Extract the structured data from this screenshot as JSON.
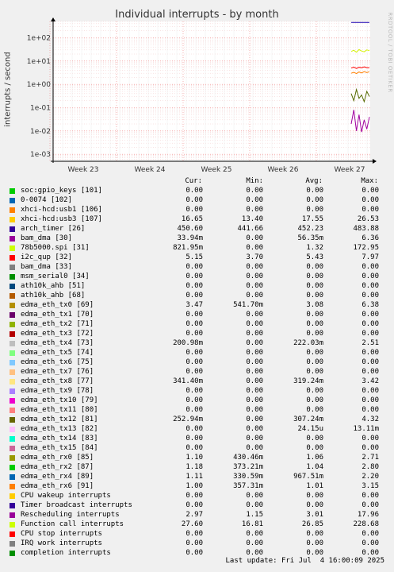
{
  "chart_data": {
    "type": "line",
    "title": "Individual interrupts - by month",
    "ylabel": "interrupts / second",
    "watermark": "RRDTOOL / TOBI OETIKER",
    "yscale": "log",
    "ylim": [
      0.0005,
      500
    ],
    "y_ticks": [
      {
        "value": 100,
        "label": "1e+02"
      },
      {
        "value": 10,
        "label": "1e+01"
      },
      {
        "value": 1,
        "label": "1e+00"
      },
      {
        "value": 0.1,
        "label": "1e-01"
      },
      {
        "value": 0.01,
        "label": "1e-02"
      },
      {
        "value": 0.001,
        "label": "1e-03"
      }
    ],
    "x_ticks": [
      "Week 23",
      "Week 24",
      "Week 25",
      "Week 26",
      "Week 27"
    ],
    "grid": true,
    "series": [
      {
        "name": "arch_timer [26]",
        "color": "#1a00b0",
        "values": [
          450,
          450,
          452,
          451,
          450,
          452,
          450,
          451
        ]
      },
      {
        "name": "Function call interrupts",
        "color": "#d4f000",
        "values": [
          26,
          29,
          24,
          31,
          27,
          25,
          30,
          28
        ]
      },
      {
        "name": "edma_eth_tx12 [81]",
        "color": "#556b00",
        "values": [
          0.4,
          0.2,
          0.6,
          0.25,
          0.35,
          0.18,
          0.5,
          0.3
        ]
      },
      {
        "name": "Rescheduling interrupts",
        "color": "#a000a0",
        "values": [
          0.02,
          0.08,
          0.01,
          0.05,
          0.009,
          0.03,
          0.012,
          0.04
        ]
      },
      {
        "name": "edma_eth_tx0 [69]",
        "color": "#ff7f00",
        "values": [
          3.0,
          3.3,
          2.9,
          3.4,
          3.1,
          3.5,
          3.2,
          3.47
        ]
      },
      {
        "name": "i2c_qup [32]",
        "color": "#ff0000",
        "values": [
          5.0,
          5.5,
          4.8,
          5.4,
          5.1,
          5.6,
          5.2,
          5.15
        ]
      }
    ]
  },
  "legend": {
    "headers": {
      "cur": "Cur:",
      "min": "Min:",
      "avg": "Avg:",
      "max": "Max:"
    },
    "rows": [
      {
        "name": "soc:gpio_keys [101]",
        "color": "#00cc00",
        "cur": "0.00",
        "min": "0.00",
        "avg": "0.00",
        "max": "0.00"
      },
      {
        "name": "0-0074 [102]",
        "color": "#0066b3",
        "cur": "0.00",
        "min": "0.00",
        "avg": "0.00",
        "max": "0.00"
      },
      {
        "name": "xhci-hcd:usb1 [106]",
        "color": "#ff8000",
        "cur": "0.00",
        "min": "0.00",
        "avg": "0.00",
        "max": "0.00"
      },
      {
        "name": "xhci-hcd:usb3 [107]",
        "color": "#ffcc00",
        "cur": "16.65",
        "min": "13.40",
        "avg": "17.55",
        "max": "26.53"
      },
      {
        "name": "arch_timer [26]",
        "color": "#330099",
        "cur": "450.60",
        "min": "441.66",
        "avg": "452.23",
        "max": "483.88"
      },
      {
        "name": "bam_dma [30]",
        "color": "#990099",
        "cur": "33.94m",
        "min": "0.00",
        "avg": "56.35m",
        "max": "6.36"
      },
      {
        "name": "78b5000.spi [31]",
        "color": "#ccff00",
        "cur": "821.95m",
        "min": "0.00",
        "avg": "1.32",
        "max": "172.95"
      },
      {
        "name": "i2c_qup [32]",
        "color": "#ff0000",
        "cur": "5.15",
        "min": "3.70",
        "avg": "5.43",
        "max": "7.97"
      },
      {
        "name": "bam_dma [33]",
        "color": "#808080",
        "cur": "0.00",
        "min": "0.00",
        "avg": "0.00",
        "max": "0.00"
      },
      {
        "name": "msm_serial0 [34]",
        "color": "#008f00",
        "cur": "0.00",
        "min": "0.00",
        "avg": "0.00",
        "max": "0.00"
      },
      {
        "name": "ath10k_ahb [51]",
        "color": "#00487d",
        "cur": "0.00",
        "min": "0.00",
        "avg": "0.00",
        "max": "0.00"
      },
      {
        "name": "ath10k_ahb [68]",
        "color": "#b35a00",
        "cur": "0.00",
        "min": "0.00",
        "avg": "0.00",
        "max": "0.00"
      },
      {
        "name": "edma_eth_tx0 [69]",
        "color": "#b38f00",
        "cur": "3.47",
        "min": "541.70m",
        "avg": "3.08",
        "max": "6.38"
      },
      {
        "name": "edma_eth_tx1 [70]",
        "color": "#6b006b",
        "cur": "0.00",
        "min": "0.00",
        "avg": "0.00",
        "max": "0.00"
      },
      {
        "name": "edma_eth_tx2 [71]",
        "color": "#8fb300",
        "cur": "0.00",
        "min": "0.00",
        "avg": "0.00",
        "max": "0.00"
      },
      {
        "name": "edma_eth_tx3 [72]",
        "color": "#b30000",
        "cur": "0.00",
        "min": "0.00",
        "avg": "0.00",
        "max": "0.00"
      },
      {
        "name": "edma_eth_tx4 [73]",
        "color": "#bebebe",
        "cur": "200.98m",
        "min": "0.00",
        "avg": "222.03m",
        "max": "2.51"
      },
      {
        "name": "edma_eth_tx5 [74]",
        "color": "#80ff80",
        "cur": "0.00",
        "min": "0.00",
        "avg": "0.00",
        "max": "0.00"
      },
      {
        "name": "edma_eth_tx6 [75]",
        "color": "#80c9ff",
        "cur": "0.00",
        "min": "0.00",
        "avg": "0.00",
        "max": "0.00"
      },
      {
        "name": "edma_eth_tx7 [76]",
        "color": "#ffc080",
        "cur": "0.00",
        "min": "0.00",
        "avg": "0.00",
        "max": "0.00"
      },
      {
        "name": "edma_eth_tx8 [77]",
        "color": "#ffe680",
        "cur": "341.40m",
        "min": "0.00",
        "avg": "319.24m",
        "max": "3.42"
      },
      {
        "name": "edma_eth_tx9 [78]",
        "color": "#aa80ff",
        "cur": "0.00",
        "min": "0.00",
        "avg": "0.00",
        "max": "0.00"
      },
      {
        "name": "edma_eth_tx10 [79]",
        "color": "#ee00cc",
        "cur": "0.00",
        "min": "0.00",
        "avg": "0.00",
        "max": "0.00"
      },
      {
        "name": "edma_eth_tx11 [80]",
        "color": "#ff8080",
        "cur": "0.00",
        "min": "0.00",
        "avg": "0.00",
        "max": "0.00"
      },
      {
        "name": "edma_eth_tx12 [81]",
        "color": "#666600",
        "cur": "252.94m",
        "min": "0.00",
        "avg": "307.24m",
        "max": "4.32"
      },
      {
        "name": "edma_eth_tx13 [82]",
        "color": "#ffbfff",
        "cur": "0.00",
        "min": "0.00",
        "avg": "24.15u",
        "max": "13.11m"
      },
      {
        "name": "edma_eth_tx14 [83]",
        "color": "#00ffcc",
        "cur": "0.00",
        "min": "0.00",
        "avg": "0.00",
        "max": "0.00"
      },
      {
        "name": "edma_eth_tx15 [84]",
        "color": "#cc6699",
        "cur": "0.00",
        "min": "0.00",
        "avg": "0.00",
        "max": "0.00"
      },
      {
        "name": "edma_eth_rx0 [85]",
        "color": "#999900",
        "cur": "1.10",
        "min": "430.46m",
        "avg": "1.06",
        "max": "2.71"
      },
      {
        "name": "edma_eth_rx2 [87]",
        "color": "#00cc00",
        "cur": "1.18",
        "min": "373.21m",
        "avg": "1.04",
        "max": "2.80"
      },
      {
        "name": "edma_eth_rx4 [89]",
        "color": "#0066b3",
        "cur": "1.11",
        "min": "330.59m",
        "avg": "967.51m",
        "max": "2.20"
      },
      {
        "name": "edma_eth_rx6 [91]",
        "color": "#ff8000",
        "cur": "1.00",
        "min": "357.31m",
        "avg": "1.01",
        "max": "3.15"
      },
      {
        "name": "CPU wakeup interrupts",
        "color": "#ffcc00",
        "cur": "0.00",
        "min": "0.00",
        "avg": "0.00",
        "max": "0.00"
      },
      {
        "name": "Timer broadcast interrupts",
        "color": "#330099",
        "cur": "0.00",
        "min": "0.00",
        "avg": "0.00",
        "max": "0.00"
      },
      {
        "name": "Rescheduling interrupts",
        "color": "#990099",
        "cur": "2.97",
        "min": "1.15",
        "avg": "3.01",
        "max": "17.96"
      },
      {
        "name": "Function call interrupts",
        "color": "#ccff00",
        "cur": "27.60",
        "min": "16.81",
        "avg": "26.85",
        "max": "228.68"
      },
      {
        "name": "CPU stop interrupts",
        "color": "#ff0000",
        "cur": "0.00",
        "min": "0.00",
        "avg": "0.00",
        "max": "0.00"
      },
      {
        "name": "IRQ work interrupts",
        "color": "#808080",
        "cur": "0.00",
        "min": "0.00",
        "avg": "0.00",
        "max": "0.00"
      },
      {
        "name": "completion interrupts",
        "color": "#008f00",
        "cur": "0.00",
        "min": "0.00",
        "avg": "0.00",
        "max": "0.00"
      }
    ]
  },
  "footer": "Last update: Fri Jul  4 16:00:09 2025"
}
